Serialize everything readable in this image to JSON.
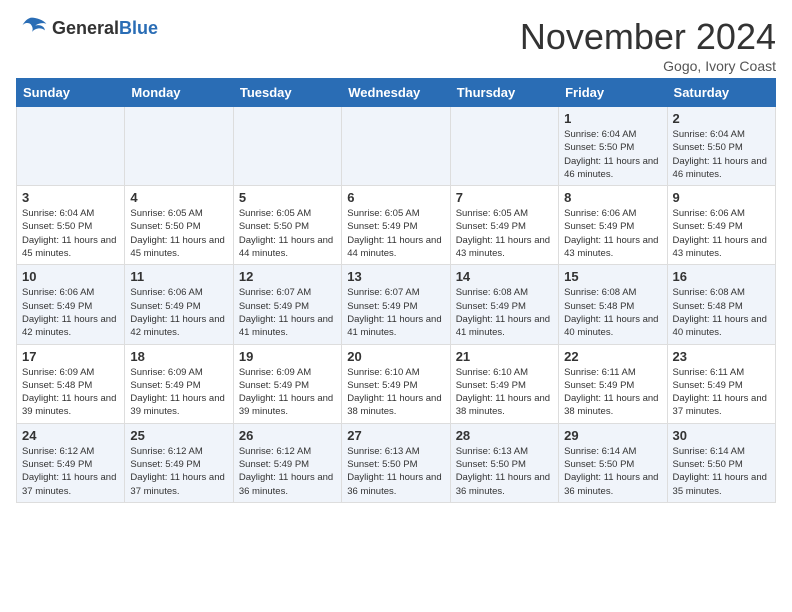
{
  "header": {
    "logo_general": "General",
    "logo_blue": "Blue",
    "month_title": "November 2024",
    "location": "Gogo, Ivory Coast"
  },
  "weekdays": [
    "Sunday",
    "Monday",
    "Tuesday",
    "Wednesday",
    "Thursday",
    "Friday",
    "Saturday"
  ],
  "weeks": [
    [
      {
        "day": "",
        "info": ""
      },
      {
        "day": "",
        "info": ""
      },
      {
        "day": "",
        "info": ""
      },
      {
        "day": "",
        "info": ""
      },
      {
        "day": "",
        "info": ""
      },
      {
        "day": "1",
        "info": "Sunrise: 6:04 AM\nSunset: 5:50 PM\nDaylight: 11 hours and 46 minutes."
      },
      {
        "day": "2",
        "info": "Sunrise: 6:04 AM\nSunset: 5:50 PM\nDaylight: 11 hours and 46 minutes."
      }
    ],
    [
      {
        "day": "3",
        "info": "Sunrise: 6:04 AM\nSunset: 5:50 PM\nDaylight: 11 hours and 45 minutes."
      },
      {
        "day": "4",
        "info": "Sunrise: 6:05 AM\nSunset: 5:50 PM\nDaylight: 11 hours and 45 minutes."
      },
      {
        "day": "5",
        "info": "Sunrise: 6:05 AM\nSunset: 5:50 PM\nDaylight: 11 hours and 44 minutes."
      },
      {
        "day": "6",
        "info": "Sunrise: 6:05 AM\nSunset: 5:49 PM\nDaylight: 11 hours and 44 minutes."
      },
      {
        "day": "7",
        "info": "Sunrise: 6:05 AM\nSunset: 5:49 PM\nDaylight: 11 hours and 43 minutes."
      },
      {
        "day": "8",
        "info": "Sunrise: 6:06 AM\nSunset: 5:49 PM\nDaylight: 11 hours and 43 minutes."
      },
      {
        "day": "9",
        "info": "Sunrise: 6:06 AM\nSunset: 5:49 PM\nDaylight: 11 hours and 43 minutes."
      }
    ],
    [
      {
        "day": "10",
        "info": "Sunrise: 6:06 AM\nSunset: 5:49 PM\nDaylight: 11 hours and 42 minutes."
      },
      {
        "day": "11",
        "info": "Sunrise: 6:06 AM\nSunset: 5:49 PM\nDaylight: 11 hours and 42 minutes."
      },
      {
        "day": "12",
        "info": "Sunrise: 6:07 AM\nSunset: 5:49 PM\nDaylight: 11 hours and 41 minutes."
      },
      {
        "day": "13",
        "info": "Sunrise: 6:07 AM\nSunset: 5:49 PM\nDaylight: 11 hours and 41 minutes."
      },
      {
        "day": "14",
        "info": "Sunrise: 6:08 AM\nSunset: 5:49 PM\nDaylight: 11 hours and 41 minutes."
      },
      {
        "day": "15",
        "info": "Sunrise: 6:08 AM\nSunset: 5:48 PM\nDaylight: 11 hours and 40 minutes."
      },
      {
        "day": "16",
        "info": "Sunrise: 6:08 AM\nSunset: 5:48 PM\nDaylight: 11 hours and 40 minutes."
      }
    ],
    [
      {
        "day": "17",
        "info": "Sunrise: 6:09 AM\nSunset: 5:48 PM\nDaylight: 11 hours and 39 minutes."
      },
      {
        "day": "18",
        "info": "Sunrise: 6:09 AM\nSunset: 5:49 PM\nDaylight: 11 hours and 39 minutes."
      },
      {
        "day": "19",
        "info": "Sunrise: 6:09 AM\nSunset: 5:49 PM\nDaylight: 11 hours and 39 minutes."
      },
      {
        "day": "20",
        "info": "Sunrise: 6:10 AM\nSunset: 5:49 PM\nDaylight: 11 hours and 38 minutes."
      },
      {
        "day": "21",
        "info": "Sunrise: 6:10 AM\nSunset: 5:49 PM\nDaylight: 11 hours and 38 minutes."
      },
      {
        "day": "22",
        "info": "Sunrise: 6:11 AM\nSunset: 5:49 PM\nDaylight: 11 hours and 38 minutes."
      },
      {
        "day": "23",
        "info": "Sunrise: 6:11 AM\nSunset: 5:49 PM\nDaylight: 11 hours and 37 minutes."
      }
    ],
    [
      {
        "day": "24",
        "info": "Sunrise: 6:12 AM\nSunset: 5:49 PM\nDaylight: 11 hours and 37 minutes."
      },
      {
        "day": "25",
        "info": "Sunrise: 6:12 AM\nSunset: 5:49 PM\nDaylight: 11 hours and 37 minutes."
      },
      {
        "day": "26",
        "info": "Sunrise: 6:12 AM\nSunset: 5:49 PM\nDaylight: 11 hours and 36 minutes."
      },
      {
        "day": "27",
        "info": "Sunrise: 6:13 AM\nSunset: 5:50 PM\nDaylight: 11 hours and 36 minutes."
      },
      {
        "day": "28",
        "info": "Sunrise: 6:13 AM\nSunset: 5:50 PM\nDaylight: 11 hours and 36 minutes."
      },
      {
        "day": "29",
        "info": "Sunrise: 6:14 AM\nSunset: 5:50 PM\nDaylight: 11 hours and 36 minutes."
      },
      {
        "day": "30",
        "info": "Sunrise: 6:14 AM\nSunset: 5:50 PM\nDaylight: 11 hours and 35 minutes."
      }
    ]
  ]
}
